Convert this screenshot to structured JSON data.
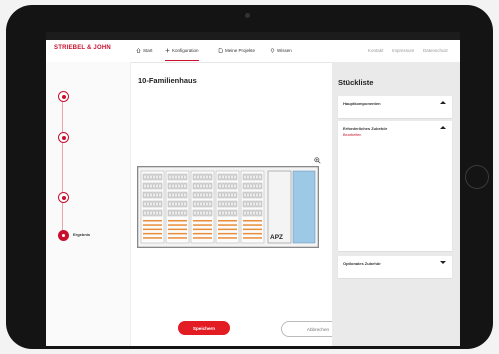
{
  "nav": {
    "logo_line1": "STRIEBEL & JOHN",
    "items": [
      {
        "label": "Start",
        "icon": "home-icon"
      },
      {
        "label": "Konfiguration",
        "icon": "plus-icon",
        "active": true
      },
      {
        "label": "Meine Projekte",
        "icon": "document-icon"
      },
      {
        "label": "Wissen",
        "icon": "location-pin-icon"
      }
    ],
    "links": [
      "Kontakt",
      "Impressum",
      "Datenschutz"
    ]
  },
  "steps": [
    {
      "label": "",
      "state": "done"
    },
    {
      "label": "",
      "state": "done"
    },
    {
      "label": "",
      "state": "done"
    },
    {
      "label": "Ergebnis",
      "state": "current"
    }
  ],
  "main": {
    "title": "10-Familienhaus",
    "col1_head": "",
    "col2_head": "",
    "col1_lines": [],
    "col2_lines": [],
    "cabinet_label": "APZ",
    "dimensions": "",
    "save_label": "Speichern",
    "cancel_label": "Abbrechen"
  },
  "parts_list": {
    "title": "Stückliste",
    "total": "",
    "main_components": {
      "label": "Hauptkomponenten",
      "count": "",
      "sum": ""
    },
    "required": {
      "label": "Erforderliches Zubehör",
      "count": "",
      "edit_label": "Bearbeiten",
      "items": [
        {
          "qty": "",
          "name": "",
          "code": "",
          "price": ""
        },
        {
          "qty": "",
          "name": "",
          "code": "",
          "price": ""
        },
        {
          "qty": "",
          "name": "",
          "code": "",
          "price": ""
        },
        {
          "qty": "",
          "name": "",
          "code": "",
          "price": ""
        }
      ]
    },
    "optional": {
      "label": "Optionales Zubehör",
      "count": "",
      "sum": ""
    }
  },
  "colors": {
    "brand_red": "#c8102e",
    "button_red": "#e31b23",
    "cabinet_blue": "#9ec9e6"
  },
  "icons": [
    "home-icon",
    "plus-icon",
    "document-icon",
    "location-pin-icon",
    "zoom-in-icon",
    "chevron-up-icon",
    "chevron-down-icon"
  ]
}
